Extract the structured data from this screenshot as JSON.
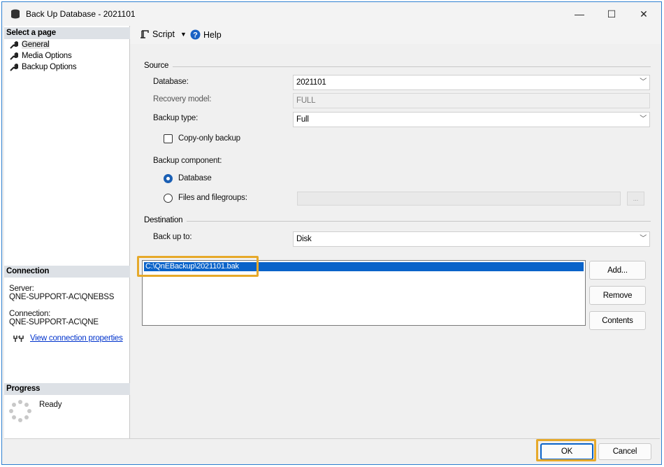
{
  "window": {
    "title": "Back Up Database - 2021101",
    "minimize": "—",
    "maximize": "☐",
    "close": "✕"
  },
  "sidebar": {
    "select_page_header": "Select a page",
    "pages": [
      {
        "label": "General",
        "icon": "wrench-icon"
      },
      {
        "label": "Media Options",
        "icon": "wrench-icon"
      },
      {
        "label": "Backup Options",
        "icon": "wrench-icon"
      }
    ],
    "connection_header": "Connection",
    "server_label": "Server:",
    "server_value": "QNE-SUPPORT-AC\\QNEBSS",
    "connection_label": "Connection:",
    "connection_value": "QNE-SUPPORT-AC\\QNE",
    "view_connection_link": "View connection properties",
    "progress_header": "Progress",
    "progress_status": "Ready"
  },
  "toolbar": {
    "script_label": "Script",
    "help_label": "Help"
  },
  "source": {
    "group_label": "Source",
    "database_label": "Database:",
    "database_value": "2021101",
    "recovery_label": "Recovery model:",
    "recovery_value": "FULL",
    "backup_type_label": "Backup type:",
    "backup_type_value": "Full",
    "copy_only_label": "Copy-only backup",
    "copy_only_checked": false,
    "component_label": "Backup component:",
    "component_database_label": "Database",
    "component_files_label": "Files and filegroups:",
    "ellipsis_label": "..."
  },
  "destination": {
    "group_label": "Destination",
    "backup_to_label": "Back up to:",
    "backup_to_value": "Disk",
    "paths": [
      "C:\\QnEBackup\\2021101.bak"
    ],
    "add_button": "Add...",
    "remove_button": "Remove",
    "contents_button": "Contents"
  },
  "footer": {
    "ok_button": "OK",
    "cancel_button": "Cancel"
  },
  "colors": {
    "highlight": "#e6a92a",
    "selection": "#0a63c9",
    "link": "#0033cc"
  }
}
